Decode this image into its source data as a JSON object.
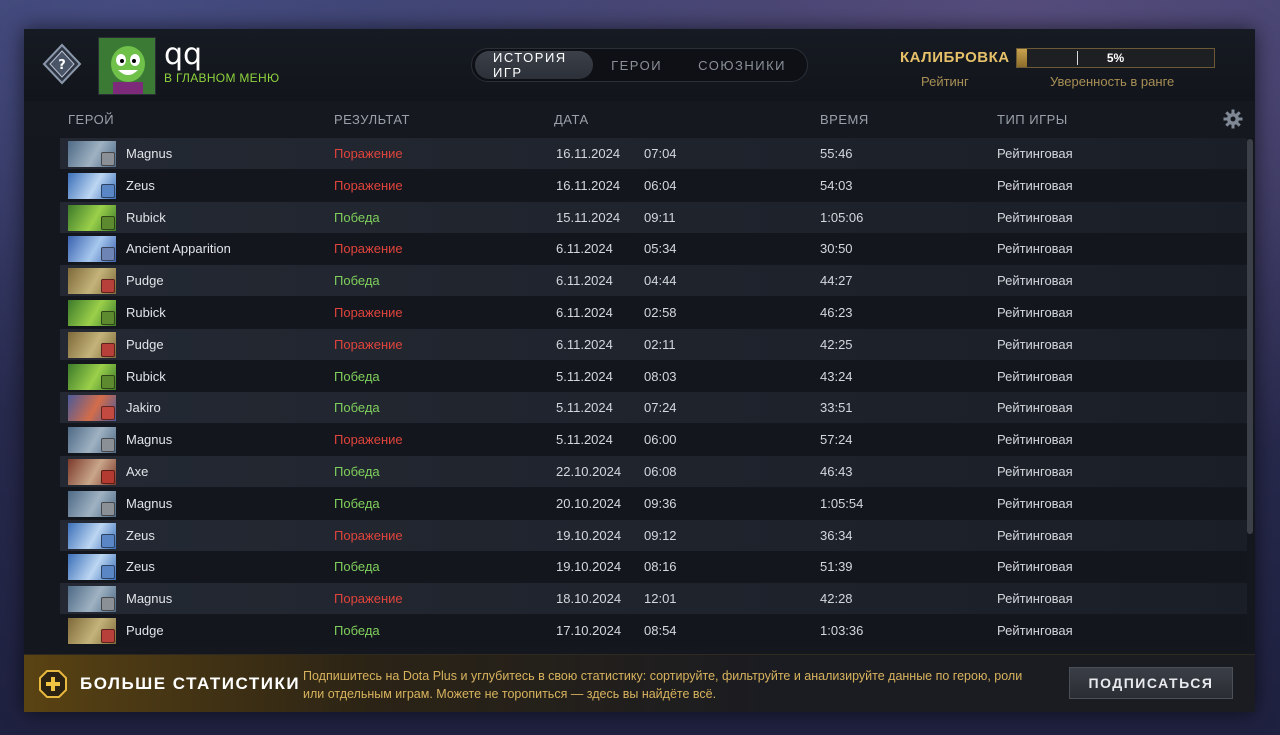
{
  "player": {
    "name": "qq",
    "status": "В ГЛАВНОМ МЕНЮ"
  },
  "tabs": [
    {
      "label": "ИСТОРИЯ ИГР",
      "active": true
    },
    {
      "label": "ГЕРОИ",
      "active": false
    },
    {
      "label": "СОЮЗНИКИ",
      "active": false
    }
  ],
  "calibration": {
    "title": "КАЛИБРОВКА",
    "rating_label": "Рейтинг",
    "confidence_value": "5%",
    "confidence_fraction": 0.05,
    "confidence_label": "Уверенность в ранге"
  },
  "columns": {
    "hero": "ГЕРОЙ",
    "result": "РЕЗУЛЬТАТ",
    "date": "ДАТА",
    "duration": "ВРЕМЯ",
    "type": "ТИП ИГРЫ"
  },
  "matches": [
    {
      "hero": "Magnus",
      "result": "Поражение",
      "win": false,
      "date": "16.11.2024",
      "time": "07:04",
      "duration": "55:46",
      "type": "Рейтинговая"
    },
    {
      "hero": "Zeus",
      "result": "Поражение",
      "win": false,
      "date": "16.11.2024",
      "time": "06:04",
      "duration": "54:03",
      "type": "Рейтинговая"
    },
    {
      "hero": "Rubick",
      "result": "Победа",
      "win": true,
      "date": "15.11.2024",
      "time": "09:11",
      "duration": "1:05:06",
      "type": "Рейтинговая"
    },
    {
      "hero": "Ancient Apparition",
      "result": "Поражение",
      "win": false,
      "date": "6.11.2024",
      "time": "05:34",
      "duration": "30:50",
      "type": "Рейтинговая"
    },
    {
      "hero": "Pudge",
      "result": "Победа",
      "win": true,
      "date": "6.11.2024",
      "time": "04:44",
      "duration": "44:27",
      "type": "Рейтинговая"
    },
    {
      "hero": "Rubick",
      "result": "Поражение",
      "win": false,
      "date": "6.11.2024",
      "time": "02:58",
      "duration": "46:23",
      "type": "Рейтинговая"
    },
    {
      "hero": "Pudge",
      "result": "Поражение",
      "win": false,
      "date": "6.11.2024",
      "time": "02:11",
      "duration": "42:25",
      "type": "Рейтинговая"
    },
    {
      "hero": "Rubick",
      "result": "Победа",
      "win": true,
      "date": "5.11.2024",
      "time": "08:03",
      "duration": "43:24",
      "type": "Рейтинговая"
    },
    {
      "hero": "Jakiro",
      "result": "Победа",
      "win": true,
      "date": "5.11.2024",
      "time": "07:24",
      "duration": "33:51",
      "type": "Рейтинговая"
    },
    {
      "hero": "Magnus",
      "result": "Поражение",
      "win": false,
      "date": "5.11.2024",
      "time": "06:00",
      "duration": "57:24",
      "type": "Рейтинговая"
    },
    {
      "hero": "Axe",
      "result": "Победа",
      "win": true,
      "date": "22.10.2024",
      "time": "06:08",
      "duration": "46:43",
      "type": "Рейтинговая"
    },
    {
      "hero": "Magnus",
      "result": "Победа",
      "win": true,
      "date": "20.10.2024",
      "time": "09:36",
      "duration": "1:05:54",
      "type": "Рейтинговая"
    },
    {
      "hero": "Zeus",
      "result": "Поражение",
      "win": false,
      "date": "19.10.2024",
      "time": "09:12",
      "duration": "36:34",
      "type": "Рейтинговая"
    },
    {
      "hero": "Zeus",
      "result": "Победа",
      "win": true,
      "date": "19.10.2024",
      "time": "08:16",
      "duration": "51:39",
      "type": "Рейтинговая"
    },
    {
      "hero": "Magnus",
      "result": "Поражение",
      "win": false,
      "date": "18.10.2024",
      "time": "12:01",
      "duration": "42:28",
      "type": "Рейтинговая"
    },
    {
      "hero": "Pudge",
      "result": "Победа",
      "win": true,
      "date": "17.10.2024",
      "time": "08:54",
      "duration": "1:03:36",
      "type": "Рейтинговая"
    }
  ],
  "hero_colors": {
    "Magnus": {
      "a": "#4e6a86",
      "b": "#9fb2c2",
      "facet": "#8b8f96"
    },
    "Zeus": {
      "a": "#3b6fb8",
      "b": "#bcd6f2",
      "facet": "#5a86c6"
    },
    "Rubick": {
      "a": "#3c7a2a",
      "b": "#9bd04a",
      "facet": "#5d8a2f"
    },
    "Ancient Apparition": {
      "a": "#3a62b0",
      "b": "#a7c8ee",
      "facet": "#6e84b4"
    },
    "Pudge": {
      "a": "#7e6a3a",
      "b": "#c4b37a",
      "facet": "#b8403a"
    },
    "Jakiro": {
      "a": "#4b5a9a",
      "b": "#d46d4a",
      "facet": "#c24a40"
    },
    "Axe": {
      "a": "#7c3a2c",
      "b": "#c9a68a",
      "facet": "#b23a30"
    }
  },
  "footer": {
    "title": "БОЛЬШЕ СТАТИСТИКИ",
    "text": "Подпишитесь на Dota Plus и углубитесь в свою статистику: сортируйте, фильтруйте и анализируйте данные по герою, роли или отдельным играм. Можете не торопиться — здесь вы найдёте всё.",
    "button": "ПОДПИСАТЬСЯ"
  },
  "colors": {
    "win": "#7fcf5c",
    "loss": "#e0443c",
    "gold": "#e6c16a",
    "status_green": "#8ed33d"
  },
  "icons": {
    "rank": "rank-unknown-badge-icon",
    "settings": "gear-icon",
    "plus": "dota-plus-icon"
  }
}
